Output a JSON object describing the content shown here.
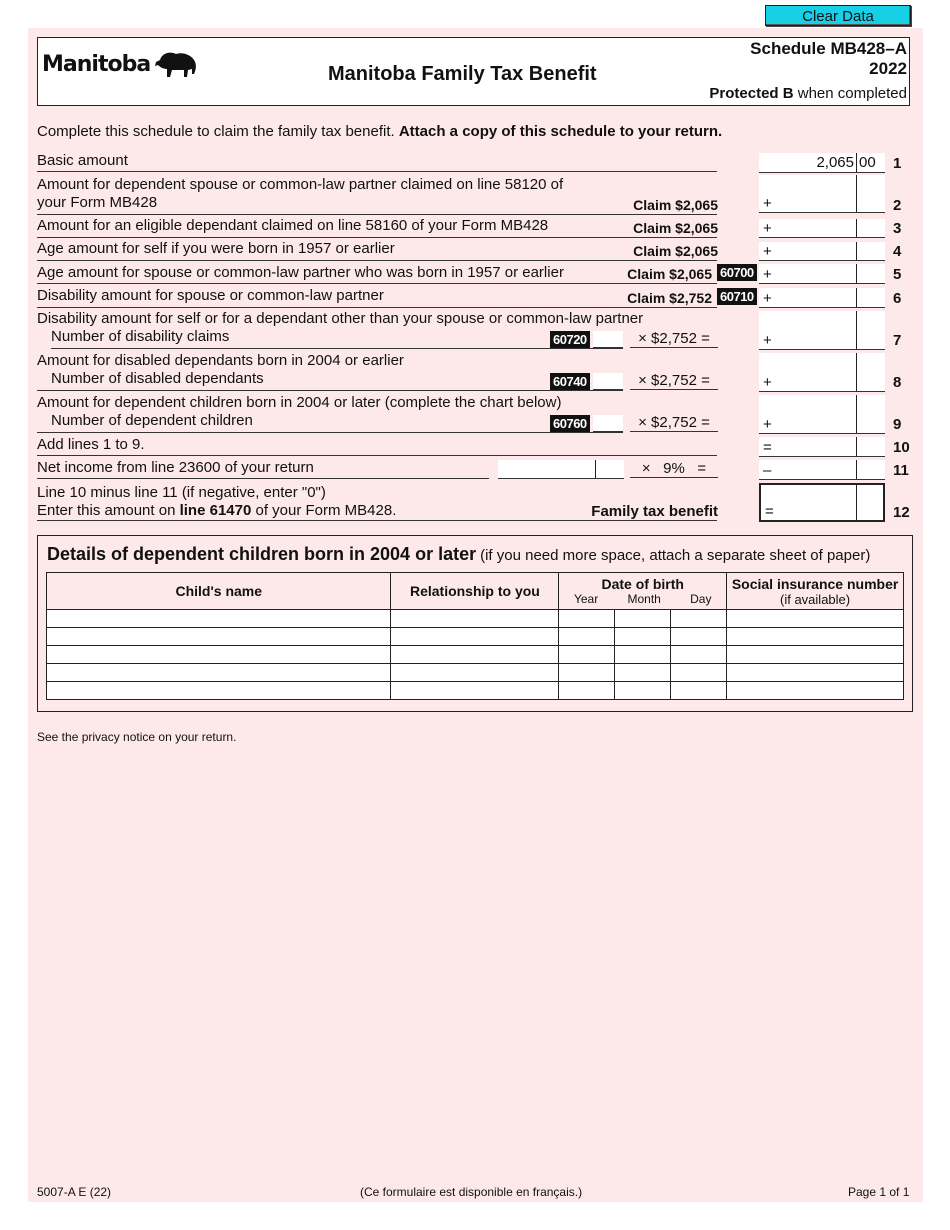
{
  "toolbar": {
    "clear_label": "Clear Data"
  },
  "header": {
    "logo_text": "Manitoba",
    "title": "Manitoba Family Tax Benefit",
    "schedule": "Schedule MB428–A",
    "year": "2022",
    "protected_bold": "Protected B",
    "protected_rest": " when completed"
  },
  "intro": {
    "text": "Complete this schedule to claim the family tax benefit. ",
    "bold": "Attach a copy of this schedule to your return."
  },
  "lines": [
    {
      "no": "1",
      "label": "Basic amount",
      "dollars": "2,065",
      "cents": "00",
      "op": ""
    },
    {
      "no": "2",
      "label": "Amount for dependent spouse or common-law partner claimed on line 58120 of",
      "label2": "your Form MB428",
      "claim": "Claim $2,065",
      "op": "+"
    },
    {
      "no": "3",
      "label": "Amount for an eligible dependant claimed on line 58160 of your Form MB428",
      "claim": "Claim $2,065",
      "op": "+"
    },
    {
      "no": "4",
      "label": "Age amount for self if you were born in 1957 or earlier",
      "claim": "Claim $2,065",
      "op": "+"
    },
    {
      "no": "5",
      "label": "Age amount for spouse or common-law partner who was born in 1957 or earlier",
      "claim": "Claim $2,065",
      "code": "60700",
      "op": "+"
    },
    {
      "no": "6",
      "label": "Disability amount for spouse or common-law partner",
      "claim": "Claim $2,752",
      "code": "60710",
      "op": "+"
    },
    {
      "no": "7",
      "label": "Disability amount for self or for a dependant other than your spouse or common-law partner",
      "label2": "Number of disability claims",
      "code": "60720",
      "mult": "× $2,752 =",
      "op": "+"
    },
    {
      "no": "8",
      "label": "Amount for disabled dependants born in 2004 or earlier",
      "label2": "Number of disabled dependants",
      "code": "60740",
      "mult": "× $2,752 =",
      "op": "+"
    },
    {
      "no": "9",
      "label": "Amount for dependent children born in 2004 or later (complete the chart below)",
      "label2": "Number of dependent children",
      "code": "60760",
      "mult": "× $2,752 =",
      "op": "+"
    },
    {
      "no": "10",
      "label": "Add lines 1 to 9.",
      "op": "="
    },
    {
      "no": "11",
      "label": "Net income from line 23600 of your return",
      "mult": "×   9%   =",
      "op": "–"
    },
    {
      "no": "12",
      "label": "Line 10 minus line 11 (if negative, enter \"0\")",
      "label2_pre": "Enter this amount on ",
      "label2_bold": "line 61470",
      "label2_post": " of your Form MB428.",
      "claim": "Family tax benefit",
      "op": "="
    }
  ],
  "details": {
    "title": "Details of dependent children born in 2004 or later",
    "note": "(if you need more space, attach a separate sheet of paper)",
    "columns": {
      "name": "Child's name",
      "relationship": "Relationship to you",
      "dob": "Date of birth",
      "year": "Year",
      "month": "Month",
      "day": "Day",
      "sin": "Social insurance number",
      "sin_sub": "(if available)"
    },
    "rows": 5
  },
  "privacy": "See the privacy notice on your return.",
  "footer": {
    "form_id": "5007-A E (22)",
    "french": "(Ce formulaire est disponible en français.)",
    "page": "Page 1 of 1"
  }
}
